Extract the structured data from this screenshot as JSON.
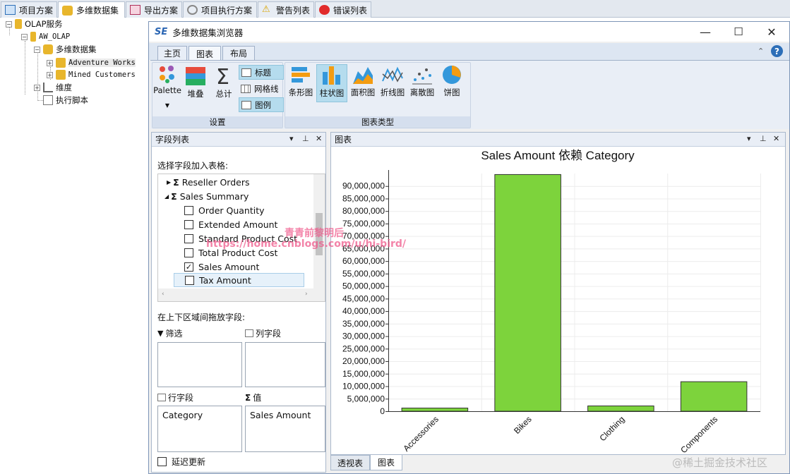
{
  "doc_tabs": [
    "项目方案",
    "多维数据集",
    "导出方案",
    "项目执行方案",
    "警告列表",
    "错误列表"
  ],
  "tree": {
    "root": "OLAP服务",
    "db": "AW_OLAP",
    "cubes": "多维数据集",
    "cube1": "Adventure Works",
    "cube2": "Mined Customers",
    "dims": "维度",
    "script": "执行脚本"
  },
  "window": {
    "logo": "SE",
    "title": "多维数据集浏览器",
    "minimize": "—",
    "maximize": "☐",
    "close": "✕"
  },
  "ribbon": {
    "tabs": [
      "主页",
      "图表",
      "布局"
    ],
    "active_tab": "图表",
    "group_settings": "设置",
    "group_types": "图表类型",
    "palette": "Palette",
    "stack": "堆叠",
    "total": "总计",
    "title_btn": "标题",
    "grid_btn": "网格线",
    "legend_btn": "图例",
    "types": [
      "条形图",
      "柱状图",
      "面积图",
      "折线图",
      "离散图",
      "饼图"
    ]
  },
  "field_pane": {
    "header": "字段列表",
    "prompt": "选择字段加入表格:",
    "fields": [
      {
        "label": "Reseller Orders",
        "kind": "measure-group",
        "checked": false
      },
      {
        "label": "Sales Summary",
        "kind": "measure-group",
        "checked": false
      },
      {
        "label": "Order Quantity",
        "kind": "field",
        "checked": false
      },
      {
        "label": "Extended Amount",
        "kind": "field",
        "checked": false
      },
      {
        "label": "Standard Product Cost",
        "kind": "field",
        "checked": false
      },
      {
        "label": "Total Product Cost",
        "kind": "field",
        "checked": false
      },
      {
        "label": "Sales Amount",
        "kind": "field",
        "checked": true
      },
      {
        "label": "Tax Amount",
        "kind": "field",
        "checked": false
      }
    ],
    "drag_prompt": "在上下区域间拖放字段:",
    "filter_label": "筛选",
    "col_label": "列字段",
    "row_label": "行字段",
    "val_label": "值",
    "row_value": "Category",
    "val_value": "Sales Amount",
    "defer_label": "延迟更新"
  },
  "chart_pane": {
    "header": "图表"
  },
  "chart_data": {
    "type": "bar",
    "title": "Sales Amount 依赖 Category",
    "categories": [
      "Accessories",
      "Bikes",
      "Clothing",
      "Components"
    ],
    "values": [
      1270000,
      94600000,
      2120000,
      11800000
    ],
    "ylim": [
      0,
      95000000
    ],
    "yticks": [
      0,
      5000000,
      10000000,
      15000000,
      20000000,
      25000000,
      30000000,
      35000000,
      40000000,
      45000000,
      50000000,
      55000000,
      60000000,
      65000000,
      70000000,
      75000000,
      80000000,
      85000000,
      90000000
    ],
    "grid": true,
    "bar_color": "#7dd33c"
  },
  "bottom_tabs": [
    "透视表",
    "图表"
  ],
  "watermark": {
    "line1": "青青前黎明后",
    "line2": "https://home.cnblogs.com/u/hi-bird/",
    "corner": "@稀土掘金技术社区"
  }
}
